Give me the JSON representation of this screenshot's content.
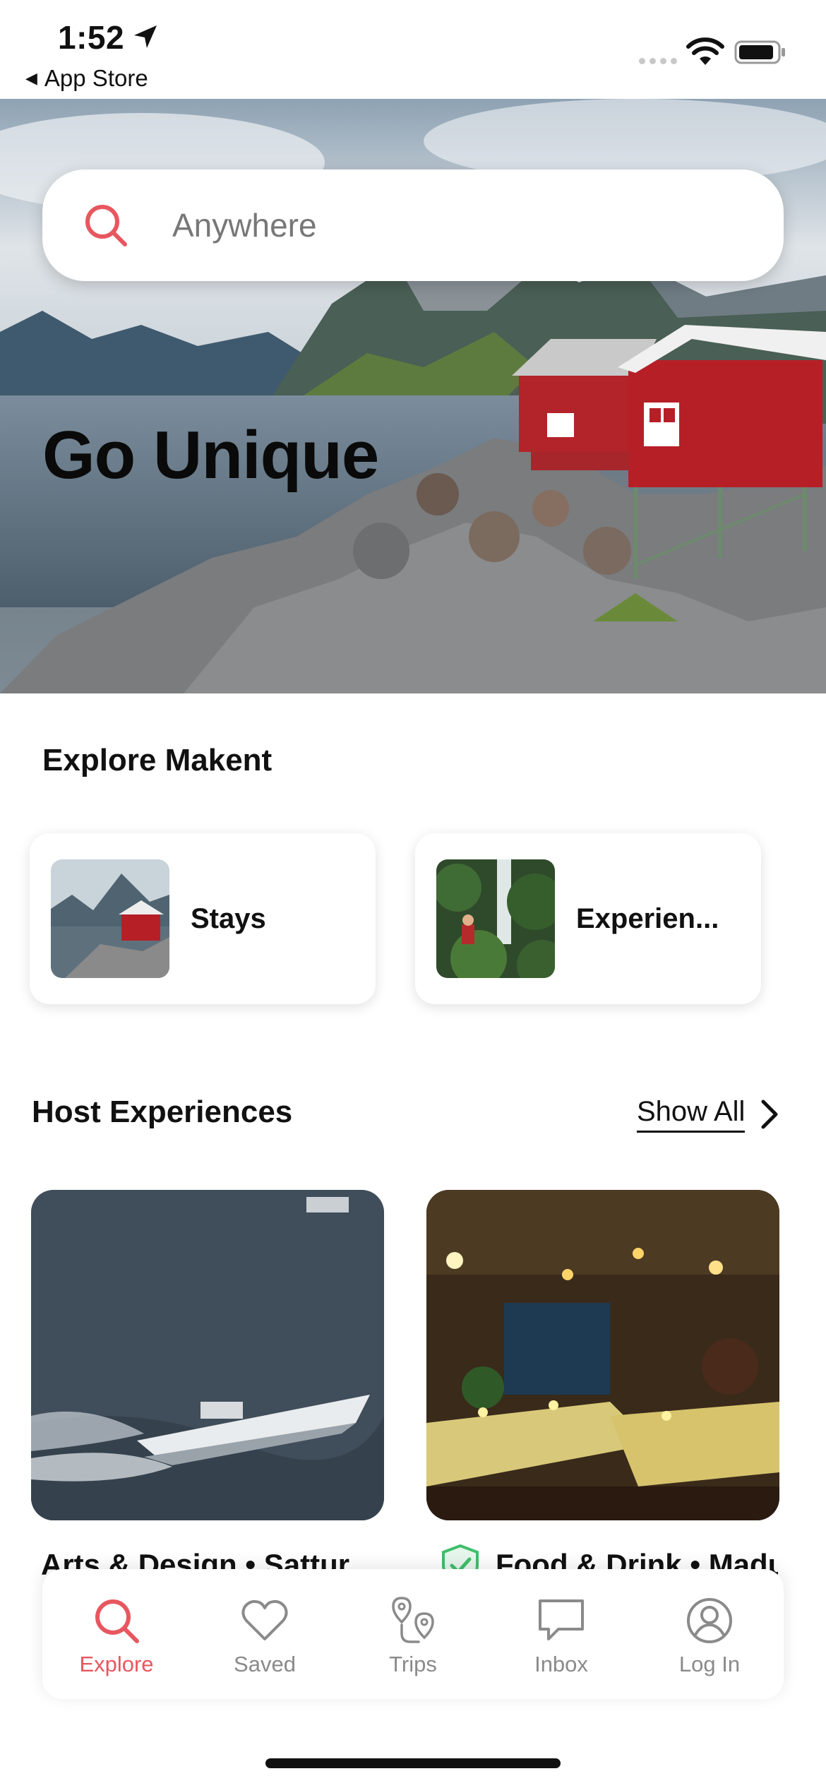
{
  "status_bar": {
    "time": "1:52",
    "back_app": "App Store"
  },
  "hero": {
    "search_placeholder": "Anywhere",
    "title": "Go Unique"
  },
  "explore": {
    "title": "Explore Makent",
    "cards": [
      {
        "label": "Stays"
      },
      {
        "label": "Experien..."
      }
    ]
  },
  "host_experiences": {
    "title": "Host Experiences",
    "show_all": "Show All",
    "items": [
      {
        "caption": "Arts & Design  •  Sattur"
      },
      {
        "caption": "Food & Drink  •  Madu"
      }
    ]
  },
  "tab_bar": {
    "tabs": [
      {
        "label": "Explore",
        "icon": "search-icon",
        "active": true
      },
      {
        "label": "Saved",
        "icon": "heart-icon",
        "active": false
      },
      {
        "label": "Trips",
        "icon": "route-icon",
        "active": false
      },
      {
        "label": "Inbox",
        "icon": "chat-icon",
        "active": false
      },
      {
        "label": "Log In",
        "icon": "user-icon",
        "active": false
      }
    ]
  },
  "colors": {
    "accent": "#e8575f",
    "inactive": "#8a8a8a"
  }
}
